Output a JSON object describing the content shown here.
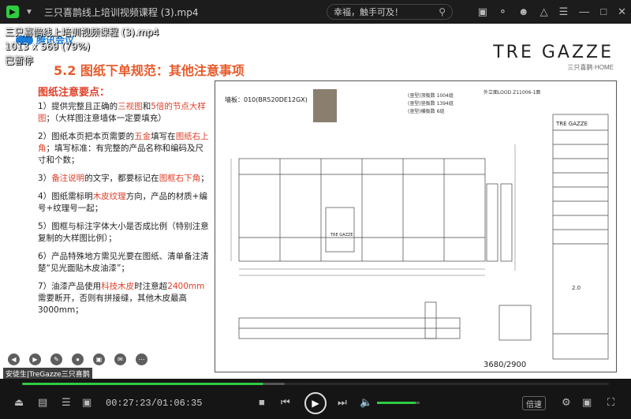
{
  "app": {
    "title": "三只喜鹊线上培训视频课程 (3).mp4",
    "search_text": "幸福，触手可及！",
    "logo_text": "▶"
  },
  "overlay": {
    "line1": "三只喜鹊线上培训视频课程 (3).mp4",
    "line2": "1013 x 569 (79%)",
    "line3": "已暂停"
  },
  "slide": {
    "corner_logo": "腾讯会议",
    "title": "5.2 图纸下单规范：其他注意事项",
    "brand_main": "TRE GAZZE",
    "brand_sub": "三只喜鹊·HOME",
    "points_head": "图纸注意要点：",
    "points": [
      {
        "pre": "1）提供完整且正确的",
        "red1": "三视图",
        "mid1": "和",
        "red2": "5倍的节点大样图",
        "post": "；（大样图注意墙体一定要填充）"
      },
      {
        "pre": "2）图纸本页把本页需要的",
        "red1": "五金",
        "mid1": "填写在",
        "red2": "图纸右上角",
        "post": "；填写标准：有完整的产品名称和编码及尺寸和个数；"
      },
      {
        "pre": "3）",
        "red1": "备注说明",
        "mid1": "的文字，都要标记在",
        "red2": "图框右下角",
        "post": "；"
      },
      {
        "pre": "4）图纸需标明",
        "red1": "木皮纹理",
        "mid1": "方向，产品的材质+编号+纹理号一起；",
        "red2": "",
        "post": ""
      },
      {
        "pre": "5）图框与标注字体大小是否成比例（特别注意复制的大样图比例）；",
        "red1": "",
        "mid1": "",
        "red2": "",
        "post": ""
      },
      {
        "pre": "6）产品特殊地方需见光要在图纸、清单备注清楚“见光面贴木皮油漆”；",
        "red1": "",
        "mid1": "",
        "red2": "",
        "post": ""
      },
      {
        "pre": "7）油漆产品使用",
        "red1": "科技木皮",
        "mid1": "时注意超",
        "red2": "2400mm",
        "post": "需要断开，否则有拼接缝，其他木皮最高3000mm；"
      }
    ],
    "drawing": {
      "wall_label": "墙板：010(BR520DE12GX)",
      "note_right": "外立面LOOD Z11006-1面",
      "dim_bottom": "3680/2900",
      "tb_brand": "TRE GAZZE",
      "tb_rev": "2.0",
      "side_notes": [
        "(竖型)顶板数 1004组",
        "(竖型)竖板数 1394组",
        "(竖型)横板数 6组"
      ]
    }
  },
  "ticker": "安徒生|TreGazze三只喜鹊",
  "player": {
    "time": "00:27:23/01:06:35",
    "progress": 0.411,
    "buffered_end": 0.448,
    "volume": 0.9,
    "speed_label": "倍速"
  },
  "colors": {
    "accent": "#2ecc40",
    "slide_red": "#e0402a"
  }
}
